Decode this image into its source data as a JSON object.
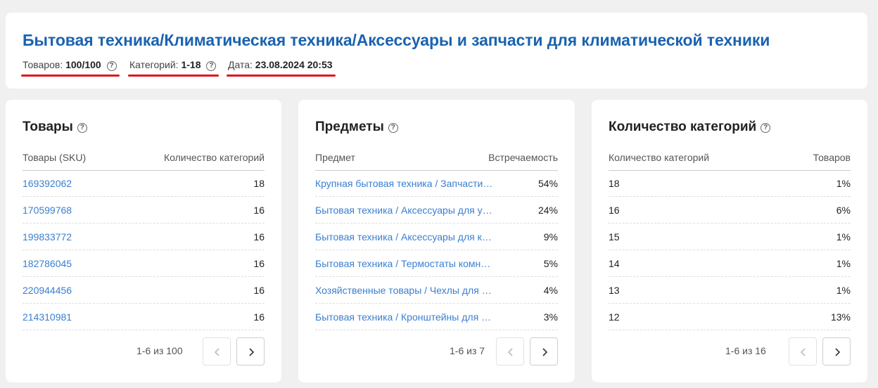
{
  "header": {
    "title": "Бытовая техника/Климатическая техника/Аксессуары и запчасти для климатической техники",
    "meta": [
      {
        "label": "Товаров:",
        "value": "100/100",
        "help": true
      },
      {
        "label": "Категорий:",
        "value": "1-18",
        "help": true
      },
      {
        "label": "Дата:",
        "value": "23.08.2024 20:53",
        "help": false
      }
    ],
    "underline_color": "#e0161b",
    "title_color": "#1a63b0"
  },
  "panels": [
    {
      "title": "Товары",
      "col1": "Товары (SKU)",
      "col2": "Количество категорий",
      "rows": [
        {
          "c1": "169392062",
          "c2": "18"
        },
        {
          "c1": "170599768",
          "c2": "16"
        },
        {
          "c1": "199833772",
          "c2": "16"
        },
        {
          "c1": "182786045",
          "c2": "16"
        },
        {
          "c1": "220944456",
          "c2": "16"
        },
        {
          "c1": "214310981",
          "c2": "16"
        }
      ],
      "pager": "1-6 из 100"
    },
    {
      "title": "Предметы",
      "col1": "Предмет",
      "col2": "Встречаемость",
      "rows": [
        {
          "c1": "Крупная бытовая техника / Запчасти…",
          "c2": "54%"
        },
        {
          "c1": "Бытовая техника / Аксессуары для у…",
          "c2": "24%"
        },
        {
          "c1": "Бытовая техника / Аксессуары для ко…",
          "c2": "9%"
        },
        {
          "c1": "Бытовая техника / Термостаты комна…",
          "c2": "5%"
        },
        {
          "c1": "Хозяйственные товары / Чехлы для ч…",
          "c2": "4%"
        },
        {
          "c1": "Бытовая техника / Кронштейны для к…",
          "c2": "3%"
        }
      ],
      "pager": "1-6 из 7"
    },
    {
      "title": "Количество категорий",
      "col1": "Количество категорий",
      "col2": "Товаров",
      "rows": [
        {
          "c1": "18",
          "c2": "1%"
        },
        {
          "c1": "16",
          "c2": "6%"
        },
        {
          "c1": "15",
          "c2": "1%"
        },
        {
          "c1": "14",
          "c2": "1%"
        },
        {
          "c1": "13",
          "c2": "1%"
        },
        {
          "c1": "12",
          "c2": "13%"
        }
      ],
      "pager": "1-6 из 16"
    }
  ],
  "icons": {
    "help": "help-circle-icon",
    "prev": "chevron-left-icon",
    "next": "chevron-right-icon"
  }
}
